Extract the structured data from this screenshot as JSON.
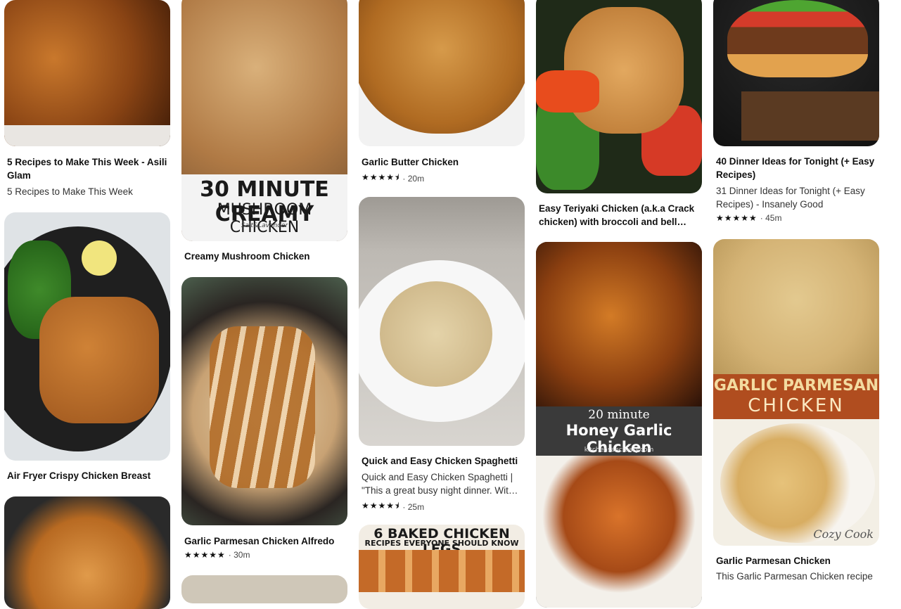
{
  "pins": {
    "p1": {
      "title": "5 Recipes to Make This Week - Asili Glam",
      "description": "5 Recipes to Make This Week"
    },
    "p2": {
      "title": "Air Fryer Crispy Chicken Breast"
    },
    "p4": {
      "title": "Creamy Mushroom Chicken",
      "overlay_line1": "30 MINUTE CREAMY",
      "overlay_line2": "MUSHROOM CHICKEN",
      "overlay_brand": "Salt&Lavender"
    },
    "p5": {
      "title": "Garlic Parmesan Chicken Alfredo",
      "stars": "★★★★★",
      "time": "· 30m"
    },
    "p7": {
      "title": "Garlic Butter Chicken",
      "stars": "★★★★⯨",
      "time": "· 20m"
    },
    "p8": {
      "title": "Quick and Easy Chicken Spaghetti",
      "description": "Quick and Easy Chicken Spaghetti | \"This a great busy night dinner. Wit…",
      "stars": "★★★★⯨",
      "time": "· 25m"
    },
    "p9": {
      "overlay_line1": "6 BAKED CHICKEN LEGS",
      "overlay_line2": "RECIPES EVERYONE SHOULD KNOW"
    },
    "p10": {
      "title": "Easy Teriyaki Chicken (a.k.a Crack chicken) with broccoli and bell…"
    },
    "p11": {
      "overlay_line1": "20 minute",
      "overlay_line2": "Honey Garlic Chicken",
      "overlay_brand": "kitchensanctuary.com"
    },
    "p12": {
      "title": "40 Dinner Ideas for Tonight (+ Easy Recipes)",
      "description": "31 Dinner Ideas for Tonight (+ Easy Recipes) - Insanely Good",
      "stars": "★★★★★",
      "time": "· 45m"
    },
    "p13": {
      "title": "Garlic Parmesan Chicken",
      "description": "This Garlic Parmesan Chicken recipe",
      "overlay_line1": "GARLIC PARMESAN",
      "overlay_line2": "CHICKEN",
      "overlay_brand": "Cozy Cook"
    }
  }
}
